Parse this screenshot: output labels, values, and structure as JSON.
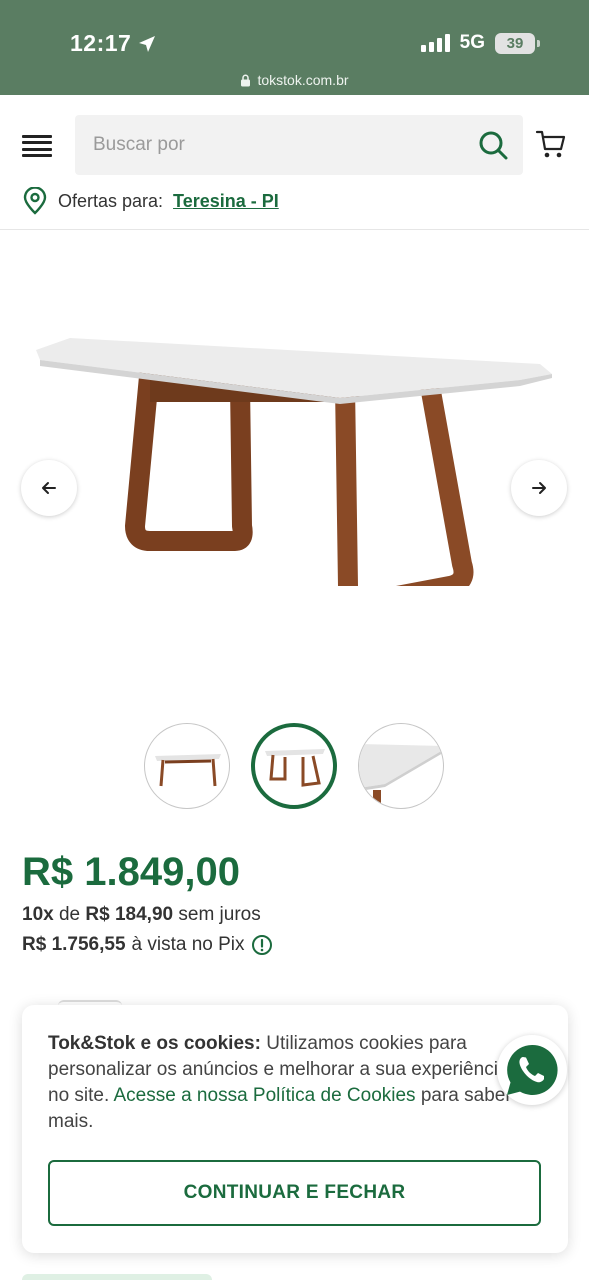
{
  "status_bar": {
    "time": "12:17",
    "network": "5G",
    "battery": "39"
  },
  "browser": {
    "url": "tokstok.com.br"
  },
  "header": {
    "search_placeholder": "Buscar por",
    "location_prefix": "Ofertas para:",
    "location_city": "Teresina - PI"
  },
  "gallery": {
    "thumbnail_count": 3,
    "active_thumbnail": 2
  },
  "price": {
    "main": "R$ 1.849,00",
    "installment_count": "10x",
    "installment_of": "de",
    "installment_value": "R$ 184,90",
    "installment_suffix": "sem juros",
    "pix_value": "R$ 1.756,55",
    "pix_suffix": "à vista no Pix"
  },
  "cookie": {
    "title": "Tok&Stok e os cookies:",
    "body": " Utilizamos cookies para personalizar os anúncios e melhorar a sua experiência no site. ",
    "link": "Acesse a nossa Política de Cookies",
    "tail": " para saber mais.",
    "button": "CONTINUAR E FECHAR"
  },
  "colors": {
    "brand_green": "#1b6b3e",
    "status_bar_bg": "#5a7d62",
    "wood": "#8a4a26",
    "tabletop": "#ececec"
  },
  "icons": [
    "location-arrow-icon",
    "lock-icon",
    "menu-icon",
    "search-icon",
    "cart-icon",
    "location-pin-icon",
    "arrow-left-icon",
    "arrow-right-icon",
    "info-icon",
    "whatsapp-icon"
  ]
}
